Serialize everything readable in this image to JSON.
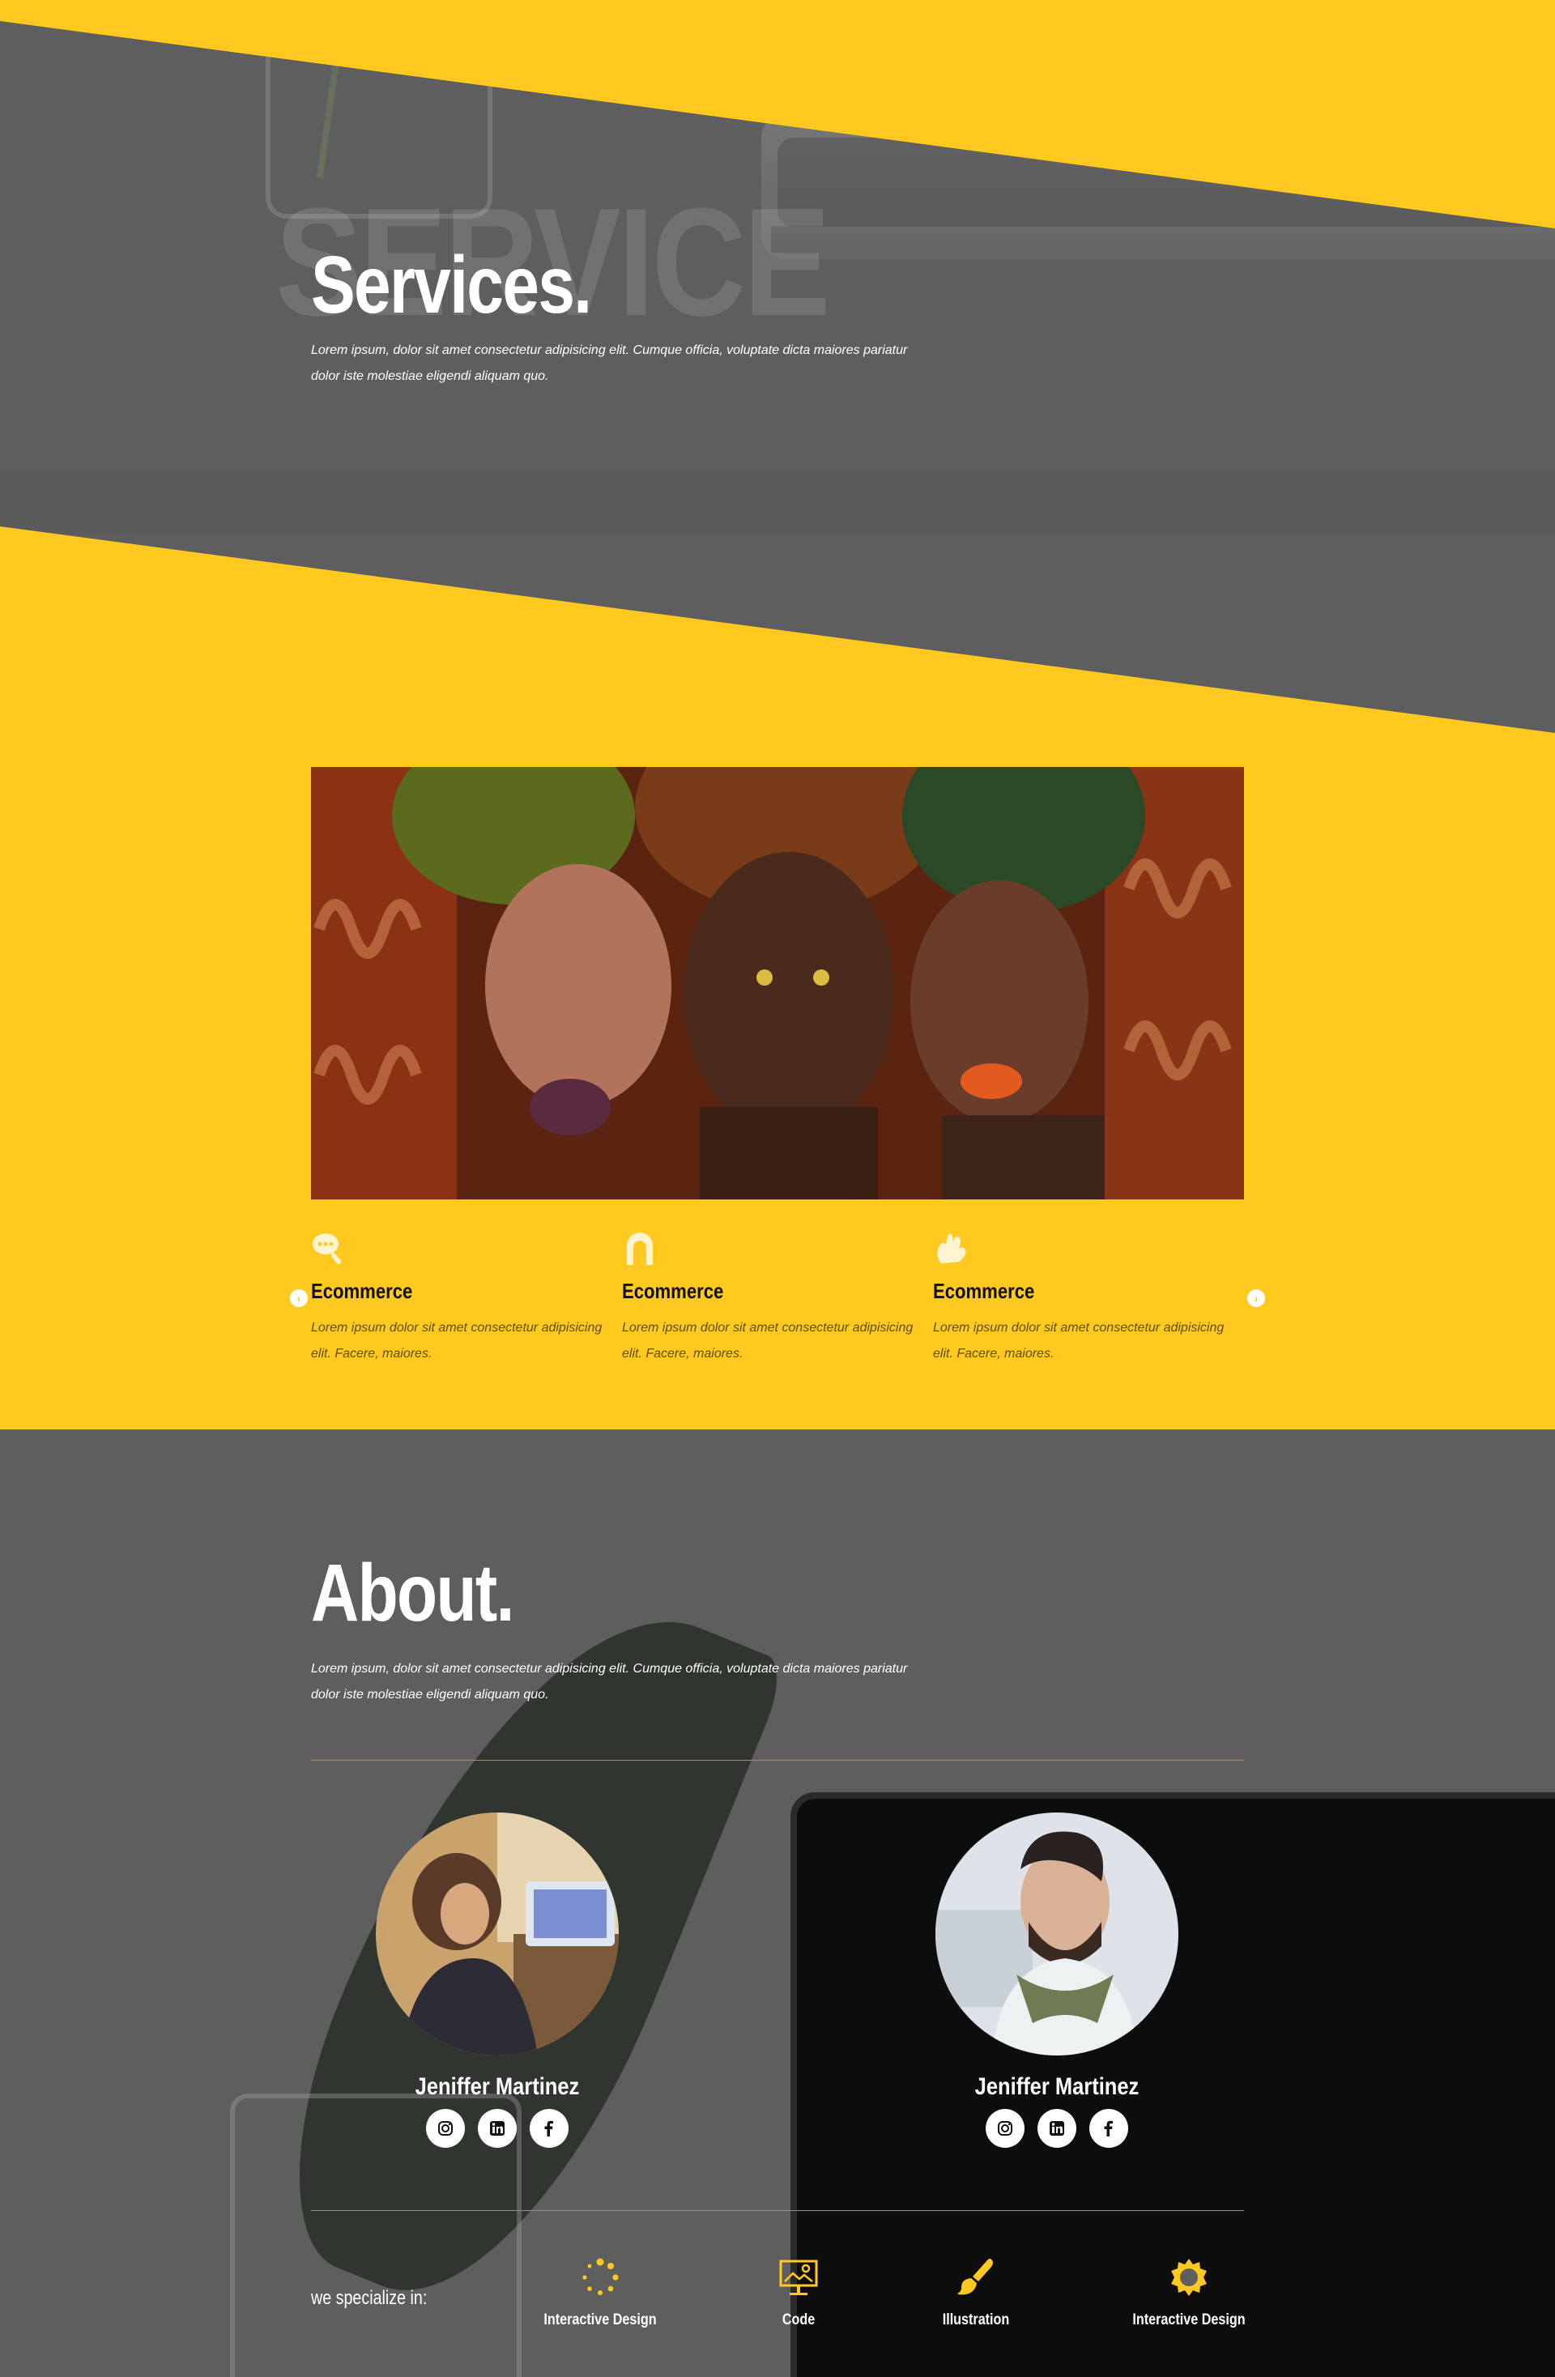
{
  "services": {
    "background_word": "SERVICE",
    "title": "Services.",
    "lead": "Lorem ipsum, dolor sit amet consectetur adipisicing elit. Cumque officia, voluptate dicta maiores pariatur dolor iste molestiae eligendi aliquam quo."
  },
  "features": [
    {
      "icon": "search-chat-icon",
      "title": "Ecommerce",
      "text": "Lorem ipsum dolor sit amet consectetur adipisicing elit. Facere, maiores."
    },
    {
      "icon": "arch-icon",
      "title": "Ecommerce",
      "text": "Lorem ipsum dolor sit amet consectetur adipisicing elit. Facere, maiores."
    },
    {
      "icon": "hand-icon",
      "title": "Ecommerce",
      "text": "Lorem ipsum dolor sit amet consectetur adipisicing elit. Facere, maiores."
    }
  ],
  "slider": {
    "prev": "‹",
    "next": "›"
  },
  "about": {
    "title": "About.",
    "lead": "Lorem ipsum, dolor sit amet consectetur adipisicing elit. Cumque officia, voluptate dicta maiores pariatur dolor iste molestiae eligendi aliquam quo."
  },
  "members": [
    {
      "name": "Jeniffer Martinez",
      "socials": [
        "instagram-icon",
        "linkedin-icon",
        "facebook-icon"
      ]
    },
    {
      "name": "Jeniffer Martinez",
      "socials": [
        "instagram-icon",
        "linkedin-icon",
        "facebook-icon"
      ]
    }
  ],
  "specialize": {
    "label": "we specialize in:",
    "items": [
      {
        "icon": "loading-dots-icon",
        "label": "Interactive Design"
      },
      {
        "icon": "presentation-board-icon",
        "label": "Code"
      },
      {
        "icon": "paint-brush-icon",
        "label": "Illustration"
      },
      {
        "icon": "sun-gear-icon",
        "label": "Interactive Design"
      }
    ]
  },
  "colors": {
    "accent": "#ffc91f",
    "dark": "#5e5e5e",
    "text": "#ffffff"
  }
}
